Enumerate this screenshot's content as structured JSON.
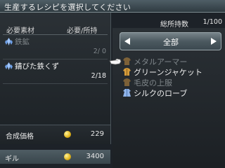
{
  "header": {
    "title": "生産するレシピを選択してください"
  },
  "materials": {
    "col_material": "必要素材",
    "col_required": "必要/所持",
    "items": [
      {
        "name": "鉄鉱",
        "quantity": "2/ 0",
        "available": false,
        "icon": "crystal-icon"
      },
      {
        "name": "錆びた鉄くず",
        "quantity": "2/18",
        "available": true,
        "icon": "crystal-icon"
      }
    ]
  },
  "price": {
    "label": "合成価格",
    "value": "229",
    "icon": "gil-coin-icon"
  },
  "gil": {
    "label": "ギル",
    "value": "3400",
    "icon": "gil-coin-icon"
  },
  "inventory": {
    "label": "総所持数",
    "count": "1/100"
  },
  "category": {
    "selected": "全部"
  },
  "recipes": [
    {
      "name": "メタルアーマー",
      "available": false,
      "icon": "armor-icon"
    },
    {
      "name": "グリーンジャケット",
      "available": true,
      "icon": "armor-icon"
    },
    {
      "name": "毛皮の上服",
      "available": false,
      "icon": "armor-icon"
    },
    {
      "name": "シルクのローブ",
      "available": true,
      "icon": "robe-icon"
    }
  ],
  "colors": {
    "accent": "#f2c230",
    "disabled": "#7f868a",
    "panel": "#1d2228"
  }
}
